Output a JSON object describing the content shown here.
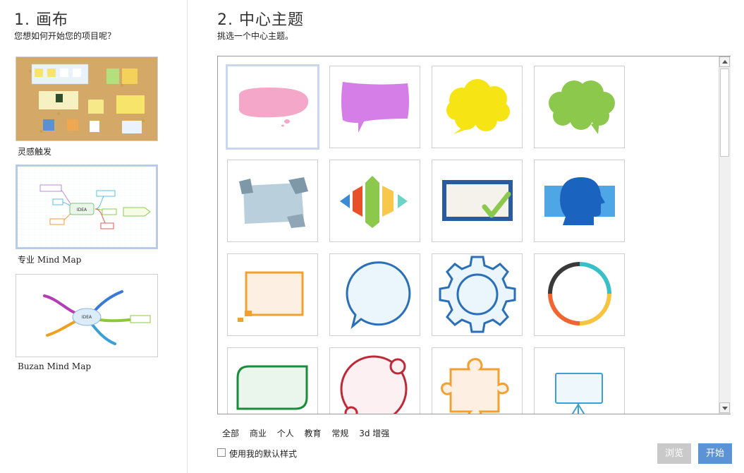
{
  "canvas_section": {
    "title": "1. 画布",
    "subtitle": "您想如何开始您的项目呢？",
    "options": [
      {
        "label": "灵感触发"
      },
      {
        "label": "专业 Mind Map"
      },
      {
        "label": "Buzan Mind Map"
      }
    ],
    "thumb_texts": {
      "pro_center": "IDEA",
      "buzan_center": "IDEA"
    }
  },
  "theme_section": {
    "title": "2. 中心主题",
    "subtitle": "挑选一个中心主题。"
  },
  "filters": [
    "全部",
    "商业",
    "个人",
    "教育",
    "常规",
    "3d 增强"
  ],
  "default_style_label": "使用我的默认样式",
  "buttons": {
    "browse": "浏览",
    "start": "开始"
  },
  "colors": {
    "accent": "#5b93d6",
    "disabled": "#c9c9c9",
    "selection": "#c8d6ee"
  }
}
